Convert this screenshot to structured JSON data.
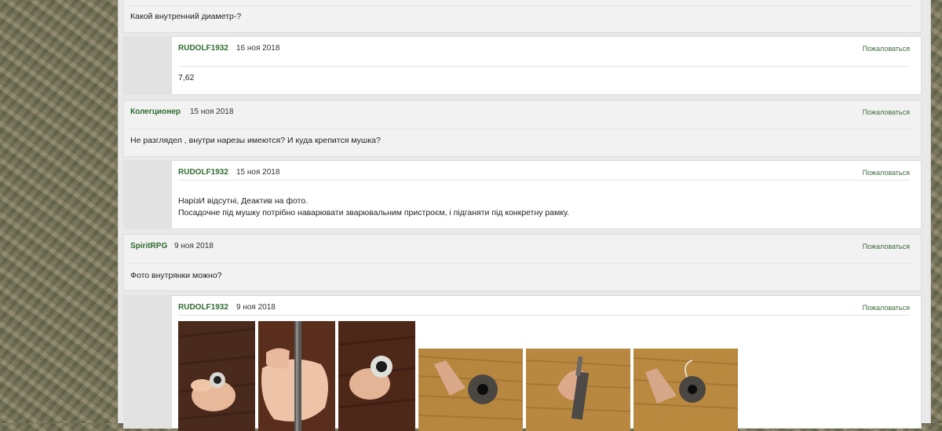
{
  "report_label": "Пожаловаться",
  "posts": [
    {
      "id": "p0",
      "body_lines": [
        "Какой внутренний диаметр-?"
      ]
    },
    {
      "id": "r1",
      "author": "RUDOLF1932",
      "date": "16 ноя 2018",
      "body_lines": [
        "7,62"
      ]
    },
    {
      "id": "p2",
      "author": "Колегционер",
      "date": "15 ноя 2018",
      "body_lines": [
        "Не разглядел , внутри нарезы имеются? И куда крепится мушка?"
      ]
    },
    {
      "id": "r3",
      "author": "RUDOLF1932",
      "date": "15 ноя 2018",
      "body_lines": [
        "НарізИ відсутні, Деактив на фото.",
        "Посадочне під мушку потрібно наварювати зварювальним пристроєм, і підганяти під конкретну рамку."
      ]
    },
    {
      "id": "p4",
      "author": "SpiritRPG",
      "date": "9 ноя 2018",
      "body_lines": [
        "Фото внутрянки можно?"
      ]
    },
    {
      "id": "r5",
      "author": "RUDOLF1932",
      "date": "9 ноя 2018",
      "photos": [
        "barrel-photo-1",
        "barrel-photo-2",
        "barrel-photo-3",
        "barrel-photo-4",
        "barrel-photo-5",
        "barrel-photo-6"
      ]
    }
  ]
}
